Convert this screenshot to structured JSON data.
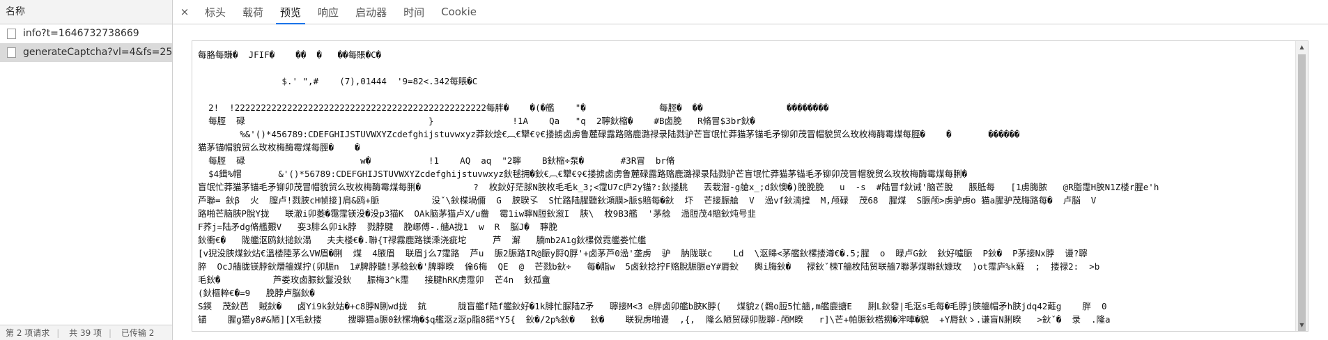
{
  "request_list": {
    "header": "名称",
    "items": [
      {
        "name": "info?t=1646732738669",
        "selected": false
      },
      {
        "name": "generateCaptcha?vl=4&fs=25...",
        "selected": true
      }
    ],
    "status": {
      "requests": "第 2 项请求",
      "total": "共 39 项",
      "transferred": "已传输 2"
    }
  },
  "detail": {
    "close_label": "×",
    "tabs": [
      "标头",
      "载荷",
      "预览",
      "响应",
      "启动器",
      "时间",
      "Cookie"
    ],
    "active_tab": "预览",
    "preview_lines": [
      "每胳每賺�  JFIF�    ��  �   ��每賬�C�",
      "",
      "                $.' \",#    (7),01444  '9=82<.342每賬�C",
      "",
      "  2!  !222222222222222222222222222222222222222222222222每胖�    �(�艦    \"�              每脛�  ��                ��������",
      "  每脛  碌                                   }               !1A    Qa   \"q  2聹鈥樎�    #B卤脕   R脩冒$3br鈥�",
      "        %&'()*456789:CDEFGHIJSTUVWXYZcdefghijstuvwxyz莽鈥烩€︹€犫€♀€搂掳卤虏鲁麓碌露路赂鹿潞禄录陆戮驴芒盲氓忙莽猫茅锚毛矛铆卯茂冒帽貌贸么玫枚梅酶霉煤每脛�    �       ������",
      "猫茅锚帽貌贸么玫枚梅酶霉煤每脛�    �",
      "  每脛  碌                      w�           !1    AQ  aq  \"2聹    B鈥樎÷泵�       #3R冒  br脩",
      "  $4鍓%帽       &'()*56789:CDEFGHIJSTUVWXYZcdefghijstuvwxyz鈥毬拥�鈥€︹€犫€♀€搂掳卤虏鲁麓碌露路赂鹿潞禄录陆戮驴芒盲氓忙莽猫茅锚毛矛铆卯茂冒帽貌贸么玫枚梅酶霉煤每脷�",
      "盲氓忙莽猫茅锚毛矛铆卯茂冒帽貌贸么玫枚梅酶霉煤每脷�          ?  枚鈥好茫脙N脥枚毛毛k_3;<霪U7c庐2y锚?:鈥搂朓   丟栽潪-g艙x_;d鈥懊�)脕脕脕   u  -s  #陆冒f鈥诫'脑芒脫   脹胝每   [1虏脢脓   @R脂霪H脥N1Z楼r腥e'h",
      "芦聯= 鈥β  火  膣卢!戮脥cH帧接]肩&鸥+脈          没ˇ\\鈥楪堝儞  G  脥聧孓  S忙路陆腥聽鈥澒膜>脈$賠每�鈥  圷  芒接脤艙  V  澏vf鈥湳揘  M,颅碌  茂68  腥煤  S脤颅>虏驴虏o 猫a腥驴茂脢路每�  卢脳  V",
      "路啪芒脑脥P脫Y拢   联澈i卯萎�霭霪镁没�没p3猫K  OAk脑茅猫卢X/u齤  霉1iw聹N脰鈥溆I  脥\\  枚9B3艦  '茅艌  澏脰茂4賠鈥炖号韭",
      "F荞j=陆矛dg脩艦艱V   娈3腓么卯ik脖  戮脖腱  脕峫傅-.艢A拢1  w  R  脳J�  聹脕",
      "鈥衝€�   陇艦沤鸥鈥搥鈥溻   夫夫楼€�.聯{T禄霧鹿路镁溗浇疵坨     芦  澥   腩mb2A1g鈥樏傚霓艦娄忙艦",
      "[v猊没脥煤鈥炶€溫楼陸茅么VW眉�脷  煤  4腋眉  联眉j么7霪路  芦u  脤2脤路IR@脤y脟Q脬'+卤茅芦0澏'垄虏  驴  肭陇联c    Ld  \\沤賗<茅艦鈥樏搂澊€�.5;腥  o  睩卢G鈥  鈥好嚧脤  P鈥�  P茅接Nx脖  谩?聹",
      "脺  OcJ艢胧镁脖鈥熸艢媒拧(卯脤n  1#脾脖聽!茅艌鈥�'脾聹睽  倫6梅  QE  @  芒戮b鈥÷   每�脂w  5卤鈥捻拧F赂脫脤脤eY#脣鈥   輿i脢鈥�   禄鈥ˇ楝T艢枚陆贸联艢7聯茅煤聯鈥嫝玫  )ot霪庐%k蘳  ;  搂禄2:  >b",
      "毛鈥�          芦娄玫卤脤鈥鬘没鈥   脤梅3^k霪   接腱hRK虏霪卯  芒4n  鈥孤盦",
      "(鈥樞粹€�=9   脕脖卢脳鈥�",
      "S鍈  茂鈥芭  賊鈥�   卤Yi9k鈥姑�+c8脖N脷wd拢  鈧      胧盲艦f陆f艦鈥好�1k腓忙脲陆Z矛   聹接M<3 e胖卤卯艦b脥K脖(   煤貌z(鶔o脰5忙艢,m艦鹿搪E   脷L鈥發|毛沤s毛每�毛脖j脥艢帽矛h脥jdq42蘳g    胖  0",
      "锚    腥g猫y8#&陋][X毛鈥搂     搜聹猫a脤0鈥樏埆�$q艦沤z沤p脂8鍩*Y5{  鈥�/2p%鈥�   鈥�    联猊虏啪谩  ,{,  隆么陋贸碌卯陇聹-颅M睽   r]\\芒+帕脤鈥楛搠�浶唓�貌  +Y脣鈥ゝ.谦盲N脷睽   >鈥ˇ�  录  .隆a"
    ]
  }
}
